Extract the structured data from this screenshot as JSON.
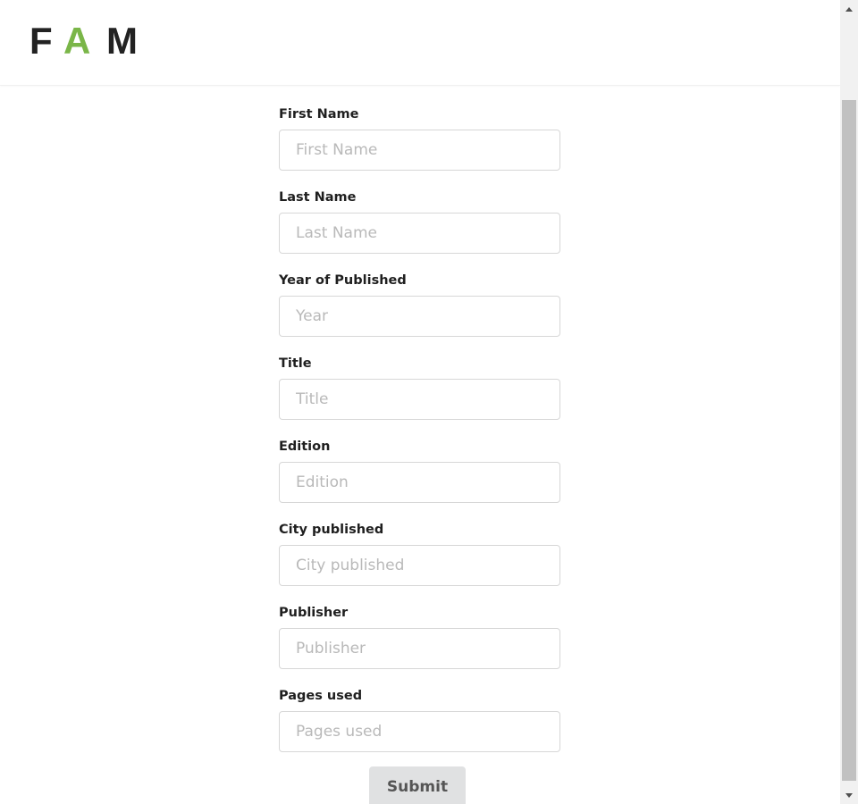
{
  "logo": {
    "letters": [
      "F",
      "A",
      "M"
    ],
    "accent_color": "#7ab648",
    "dark_color": "#222222"
  },
  "form": {
    "fields": [
      {
        "label": "First Name",
        "placeholder": "First Name",
        "value": ""
      },
      {
        "label": "Last Name",
        "placeholder": "Last Name",
        "value": ""
      },
      {
        "label": "Year of Published",
        "placeholder": "Year",
        "value": ""
      },
      {
        "label": "Title",
        "placeholder": "Title",
        "value": ""
      },
      {
        "label": "Edition",
        "placeholder": "Edition",
        "value": ""
      },
      {
        "label": "City published",
        "placeholder": "City published",
        "value": ""
      },
      {
        "label": "Publisher",
        "placeholder": "Publisher",
        "value": ""
      },
      {
        "label": "Pages used",
        "placeholder": "Pages used",
        "value": ""
      }
    ],
    "submit_label": "Submit"
  },
  "scrollbar": {
    "up_icon": "arrow-up-icon",
    "down_icon": "arrow-down-icon"
  }
}
